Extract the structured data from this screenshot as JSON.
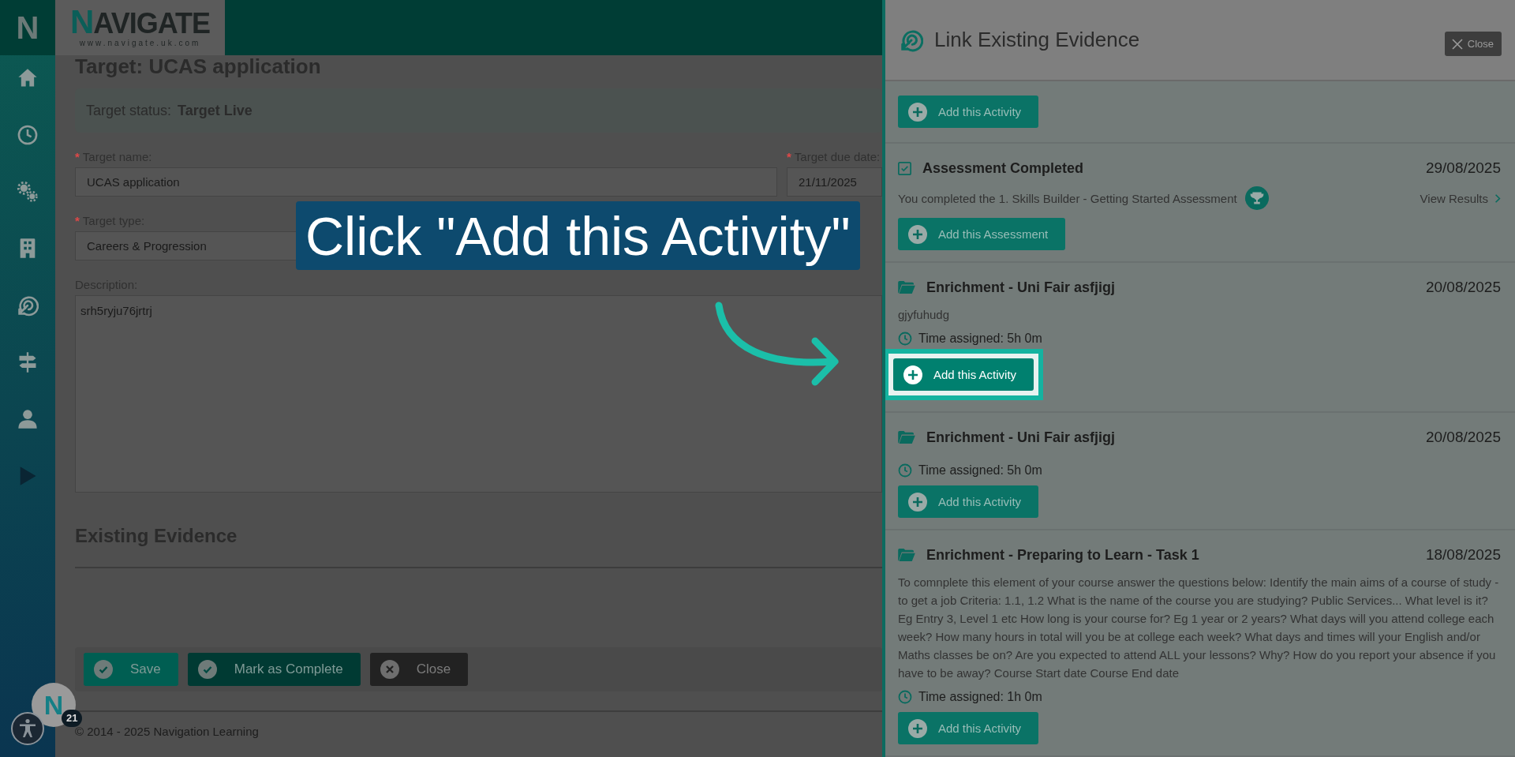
{
  "sidebar": {
    "logo": "N"
  },
  "header": {
    "logo_title": "NAVIGATE",
    "logo_url": "www.navigate.uk.com"
  },
  "page": {
    "title": "Target: UCAS application",
    "status": {
      "label": "Target status:",
      "value": "Target Live"
    },
    "fields": [
      {
        "kind": "text",
        "label": "Target name:",
        "required_mark": "*",
        "value": "UCAS application"
      },
      {
        "kind": "text",
        "label": "Target due date:",
        "required_mark": "*",
        "value": "21/11/2025"
      },
      {
        "kind": "text",
        "label": "Target type:",
        "required_mark": "*",
        "value": "Careers & Progression"
      },
      {
        "kind": "textarea",
        "label": "Description:",
        "value": "srh5ryju76jrtrj"
      }
    ],
    "section_title": "Existing Evidence",
    "buttons": [
      {
        "kind": "save",
        "label": "Save"
      },
      {
        "kind": "complete",
        "label": "Mark as Complete"
      },
      {
        "kind": "close",
        "label": "Close"
      }
    ],
    "footer": "© 2014 - 2025 Navigation Learning"
  },
  "chat_widget": {
    "letter": "N",
    "badge": "21"
  },
  "panel": {
    "title": "Link Existing Evidence",
    "close": "Close",
    "items": [
      {
        "kind": "button_only",
        "button": "Add this Activity",
        "highlighted": false
      },
      {
        "kind": "assessment",
        "title": "Assessment Completed",
        "date": "29/08/2025",
        "text": "You completed the 1. Skills Builder - Getting Started Assessment",
        "link": "View Results",
        "button": "Add this Assessment",
        "highlighted": false
      },
      {
        "kind": "activity",
        "title": "Enrichment - Uni Fair asfjigj",
        "date": "20/08/2025",
        "text": "gjyfuhudg",
        "time": "Time assigned: 5h 0m",
        "button": "Add this Activity",
        "highlighted": true
      },
      {
        "kind": "activity",
        "title": "Enrichment - Uni Fair asfjigj",
        "date": "20/08/2025",
        "time": "Time assigned: 5h 0m",
        "button": "Add this Activity",
        "highlighted": false
      },
      {
        "kind": "activity",
        "title": "Enrichment - Preparing to Learn - Task 1",
        "date": "18/08/2025",
        "text": "To comnplete this element of your course answer the questions below: Identify the main aims of a course of study - to get a job Criteria: 1.1, 1.2 What is the name of the course you are studying? Public Services... What level is it? Eg Entry 3, Level 1 etc How long is your course for? Eg 1 year or 2 years? What days will you attend college each week? How many hours in total will you be at college each week? What days and times will your English and/or Maths classes be on? Are you expected to attend ALL your lessons? Why? How do you report your absence if you have to be away? Course Start date Course End date",
        "time": "Time assigned: 1h 0m",
        "button": "Add this Activity",
        "highlighted": false
      }
    ]
  },
  "callout": {
    "text": "Click \"Add this Activity\""
  }
}
